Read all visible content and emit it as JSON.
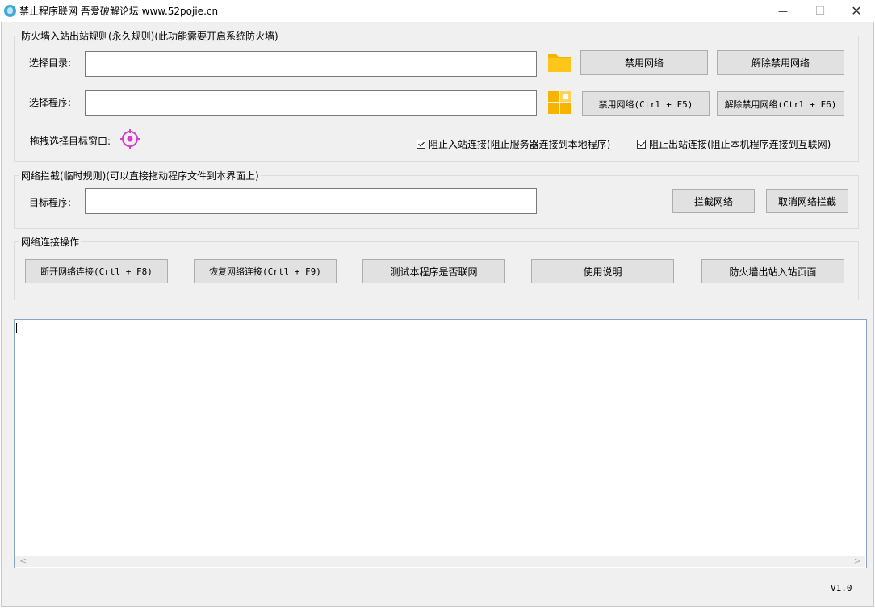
{
  "window": {
    "title": "禁止程序联网 吾爱破解论坛 www.52pojie.cn",
    "controls": [
      "—",
      "☐",
      "✕"
    ]
  },
  "firewall_group": {
    "legend": "防火墙入站出站规则(永久规则)(此功能需要开启系统防火墙)",
    "dir_label": "选择目录:",
    "dir_value": "",
    "prog_label": "选择程序:",
    "prog_value": "",
    "drag_label": "拖拽选择目标窗口:",
    "btn_disable_net": "禁用网络",
    "btn_enable_net": "解除禁用网络",
    "btn_disable_net_hotkey": "禁用网络(Ctrl + F5)",
    "btn_enable_net_hotkey": "解除禁用网络(Ctrl + F6)",
    "chk_block_inbound": "阻止入站连接(阻止服务器连接到本地程序)",
    "chk_block_outbound": "阻止出站连接(阻止本机程序连接到互联网)"
  },
  "intercept_group": {
    "legend": "网络拦截(临时规则)(可以直接拖动程序文件到本界面上)",
    "target_label": "目标程序:",
    "target_value": "",
    "btn_intercept": "拦截网络",
    "btn_cancel_intercept": "取消网络拦截"
  },
  "ops_group": {
    "legend": "网络连接操作",
    "btn_disconnect": "断开网络连接(Crtl + F8)",
    "btn_restore": "恢复网络连接(Crtl + F9)",
    "btn_test": "测试本程序是否联网",
    "btn_help": "使用说明",
    "btn_fw_page": "防火墙出站入站页面"
  },
  "log": {
    "content": ""
  },
  "status": {
    "version": "V1.0"
  },
  "colors": {
    "accent": "#3fa9d8",
    "folder": "#f6b400",
    "target": "#d43fd0"
  }
}
